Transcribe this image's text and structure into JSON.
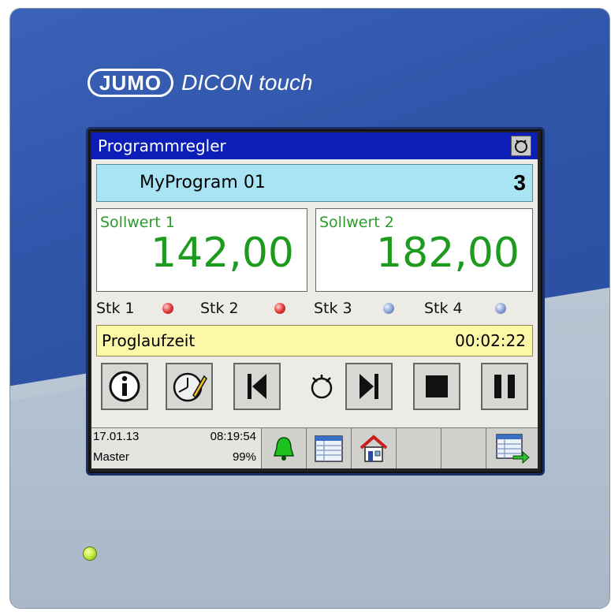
{
  "device": {
    "brand": "JUMO",
    "model": "DICON touch"
  },
  "screen": {
    "title": "Programmregler",
    "program": {
      "name": "MyProgram 01",
      "number": "3"
    },
    "setpoints": [
      {
        "label": "Sollwert 1",
        "value": "142,00"
      },
      {
        "label": "Sollwert 2",
        "value": "182,00"
      }
    ],
    "stk": [
      {
        "label": "Stk 1",
        "state": "red"
      },
      {
        "label": "Stk 2",
        "state": "red"
      },
      {
        "label": "Stk 3",
        "state": "blue"
      },
      {
        "label": "Stk 4",
        "state": "blue"
      }
    ],
    "runtime": {
      "label": "Proglaufzeit",
      "value": "00:02:22"
    },
    "buttons": [
      "info-icon",
      "clock-edit-icon",
      "previous-segment-icon",
      "program-cycle-icon",
      "next-segment-icon",
      "stop-icon",
      "pause-icon"
    ],
    "status": {
      "date": "17.01.13",
      "time": "08:19:54",
      "role": "Master",
      "percent": "99%"
    },
    "status_buttons": [
      "bell-icon",
      "list-view-icon",
      "home-icon",
      "empty",
      "empty",
      "list-forward-icon"
    ]
  },
  "colors": {
    "titlebar": "#0b1fb8",
    "program_bg": "#a9e4f4",
    "setpoint_text": "#1e9a1e",
    "runtime_bg": "#fdf7a8",
    "device_blue": "#2f55a9",
    "led": "#c8f042"
  }
}
